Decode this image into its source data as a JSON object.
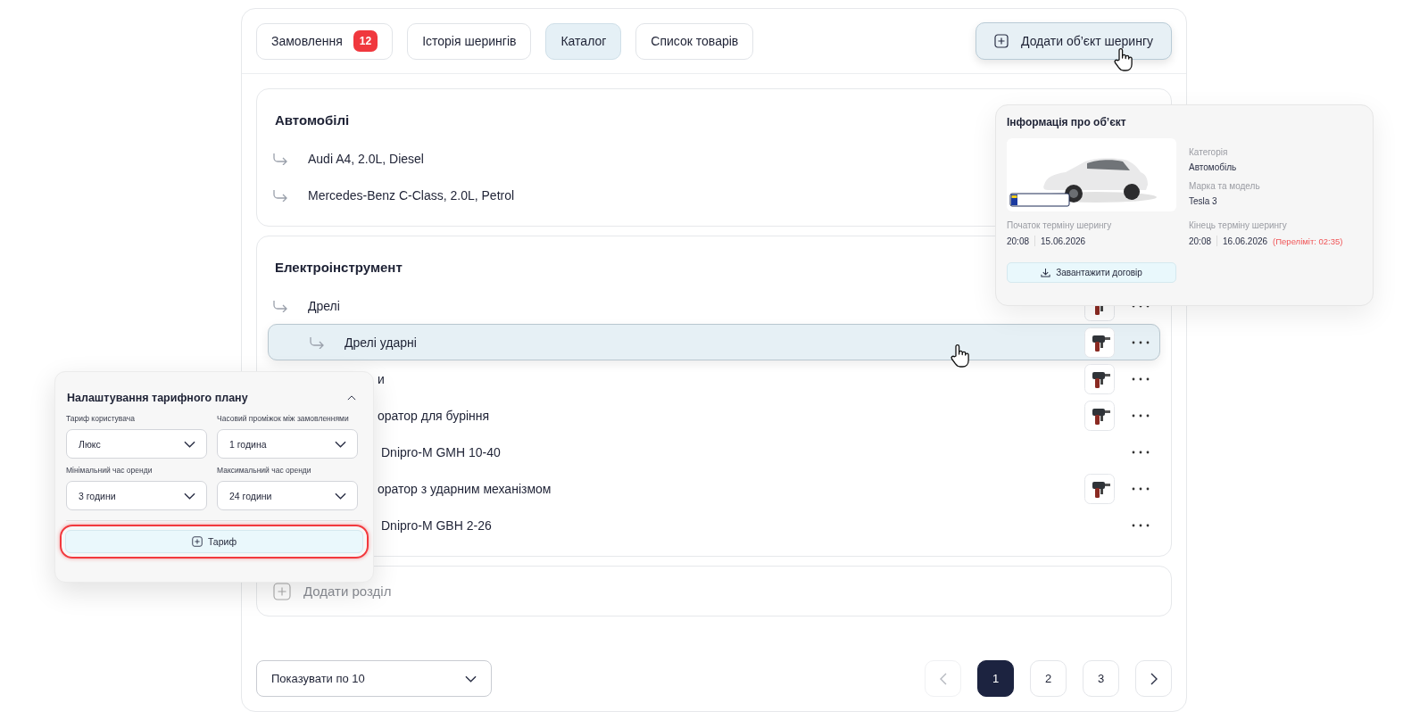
{
  "tabs": [
    {
      "label": "Замовлення",
      "badge": "12",
      "selected": false
    },
    {
      "label": "Історія шерингів",
      "selected": false
    },
    {
      "label": "Каталог",
      "selected": true
    },
    {
      "label": "Список товарів",
      "selected": false
    }
  ],
  "add_object_button": "Додати об’єкт шерингу",
  "sections": [
    {
      "title": "Автомобілі",
      "items": [
        {
          "label": "Audi A4, 2.0L, Diesel",
          "kind": "row",
          "selected": false,
          "thumbnail": false,
          "more_menu": false
        },
        {
          "label": "Mercedes-Benz C-Class, 2.0L, Petrol",
          "kind": "row",
          "selected": false,
          "thumbnail": false,
          "more_menu": false
        }
      ]
    },
    {
      "title": "Електроінструмент",
      "items": [
        {
          "label": "Дрелі",
          "kind": "row",
          "selected": false,
          "thumbnail": true,
          "more_menu": true,
          "children": [
            {
              "label": "Дрелі ударні",
              "kind": "row",
              "selected": true,
              "thumbnail": true,
              "more_menu": true
            }
          ]
        },
        {
          "label": "и",
          "kind": "covered",
          "selected": false,
          "thumbnail": true,
          "more_menu": true,
          "children": [
            {
              "label": "оратор для буріння",
              "kind": "covered",
              "selected": false,
              "thumbnail": true,
              "more_menu": true,
              "children": [
                {
                  "label": "Dnipro-M GMH 10-40",
                  "kind": "covered",
                  "selected": false,
                  "thumbnail": false,
                  "more_menu": true
                }
              ]
            },
            {
              "label": "оратор з ударним механізмом",
              "kind": "covered",
              "selected": false,
              "thumbnail": true,
              "more_menu": true,
              "children": [
                {
                  "label": "Dnipro-M GBH 2-26",
                  "kind": "covered",
                  "selected": false,
                  "thumbnail": false,
                  "more_menu": true
                }
              ]
            }
          ]
        }
      ]
    }
  ],
  "add_section": "Додати розділ",
  "page_size": "Показувати по 10",
  "pagination": {
    "prev_disabled": true,
    "pages": [
      {
        "label": "1",
        "selected": true
      },
      {
        "label": "2",
        "selected": false
      },
      {
        "label": "3",
        "selected": false
      }
    ]
  },
  "info_panel": {
    "title": "Інформація про об’єкт",
    "fields": [
      {
        "label": "Категорія",
        "value": "Автомобіль"
      },
      {
        "label": "Марка та модель",
        "value": "Tesla 3"
      }
    ],
    "start": {
      "label": "Початок терміну шерингу",
      "time": "20:08",
      "date": "15.06.2026"
    },
    "end": {
      "label": "Кінець терміну шерингу",
      "time": "20:08",
      "date": "16.06.2026",
      "overdue": "(Переліміт: 02:35)"
    },
    "download_button": "Завантажити договір"
  },
  "tariff_panel": {
    "title": "Налаштування тарифного плану",
    "expanded": true,
    "fields": [
      {
        "label": "Тариф користувача",
        "value": "Люкс"
      },
      {
        "label": "Часовий проміжок між замовленнями",
        "value": "1 година"
      },
      {
        "label": "Мінімальний час оренди",
        "value": "3 години"
      },
      {
        "label": "Максимальний час оренди",
        "value": "24 години"
      }
    ],
    "add_button": "Тариф",
    "highlighted": true
  }
}
